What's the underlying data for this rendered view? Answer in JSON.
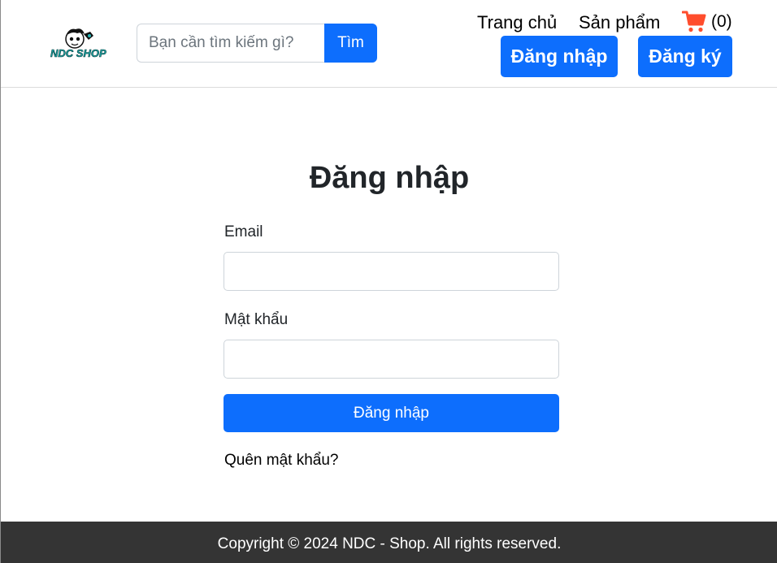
{
  "header": {
    "logo_text": "NDC SHOP",
    "search": {
      "placeholder": "Bạn cần tìm kiếm gì?",
      "value": "",
      "button_label": "Tìm"
    },
    "nav": {
      "home": "Trang chủ",
      "products": "Sản phẩm"
    },
    "cart": {
      "count": "(0)",
      "icon": "shopping-cart-icon",
      "icon_color": "#ff4d2d"
    },
    "login_button": "Đăng nhập",
    "register_button": "Đăng ký"
  },
  "main": {
    "title": "Đăng nhập",
    "email_label": "Email",
    "email_value": "",
    "password_label": "Mật khẩu",
    "password_value": "",
    "submit_label": "Đăng nhập",
    "forgot_link": "Quên mật khẩu?"
  },
  "footer": {
    "copyright": "Copyright © 2024 NDC - Shop. All rights reserved."
  },
  "colors": {
    "primary": "#0d6efd",
    "footer_bg": "#343434"
  }
}
